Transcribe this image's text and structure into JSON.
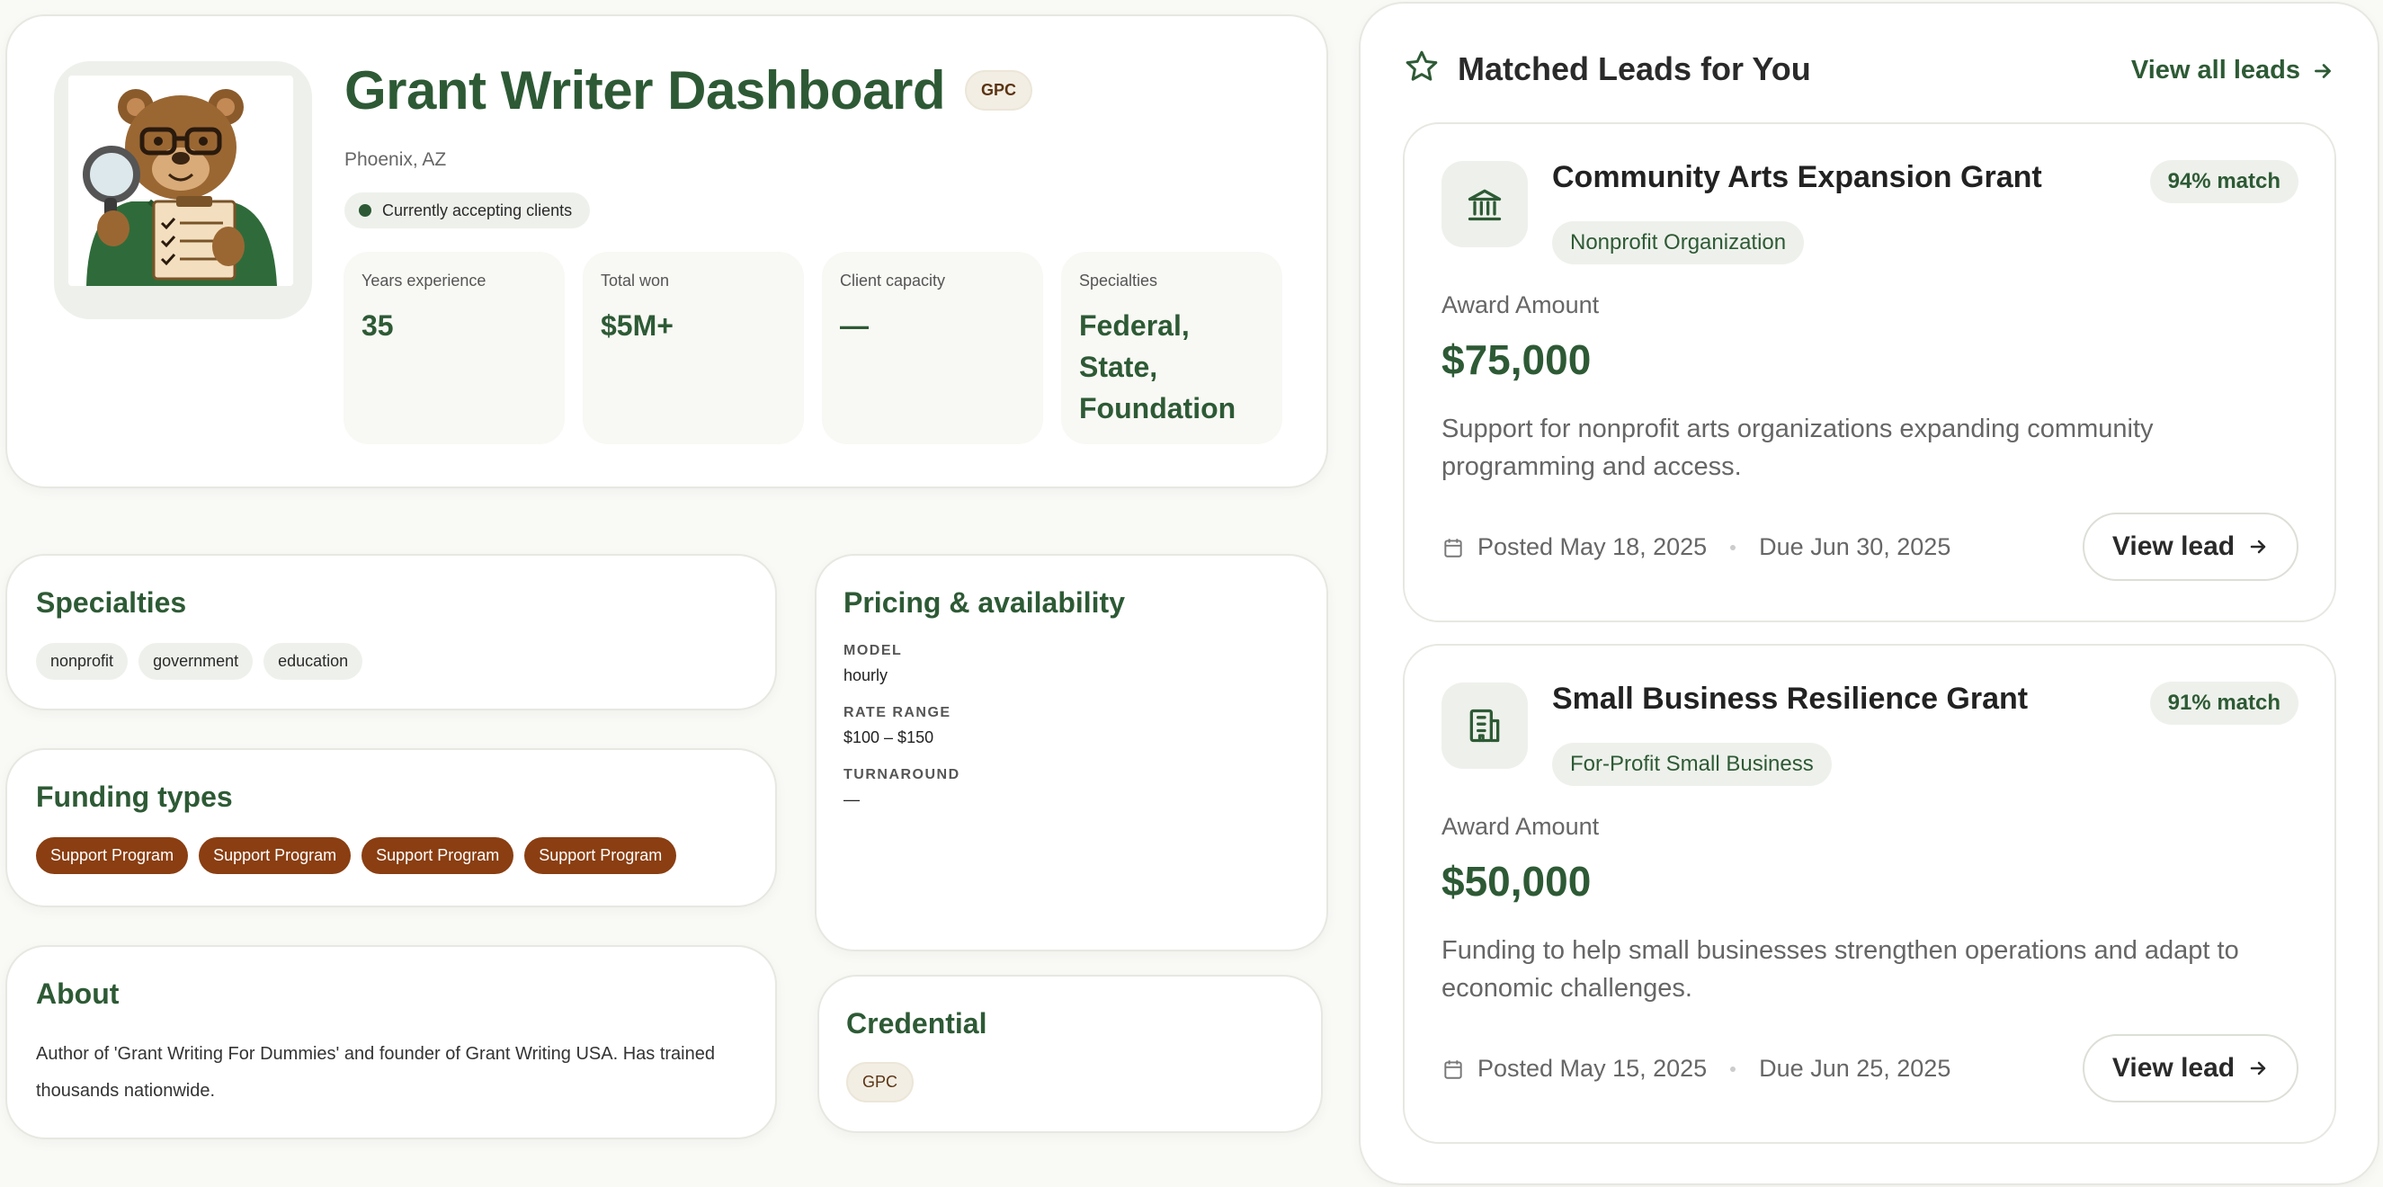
{
  "profile": {
    "title": "Grant Writer Dashboard",
    "credential_badge": "GPC",
    "location": "Phoenix, AZ",
    "status": "Currently accepting clients",
    "stats": [
      {
        "label": "Years experience",
        "value": "35"
      },
      {
        "label": "Total won",
        "value": "$5M+"
      },
      {
        "label": "Client capacity",
        "value": "—"
      },
      {
        "label": "Specialties",
        "value": "Federal, State, Foundation"
      }
    ]
  },
  "specialties": {
    "title": "Specialties",
    "tags": [
      "nonprofit",
      "government",
      "education"
    ]
  },
  "funding": {
    "title": "Funding types",
    "tags": [
      "Support Program",
      "Support Program",
      "Support Program",
      "Support Program"
    ]
  },
  "about": {
    "title": "About",
    "text": "Author of 'Grant Writing For Dummies' and founder of Grant Writing USA. Has trained thousands nationwide."
  },
  "pricing": {
    "title": "Pricing & availability",
    "model_label": "MODEL",
    "model_value": "hourly",
    "rate_label": "RATE RANGE",
    "rate_value": "$100 – $150",
    "turnaround_label": "TURNAROUND",
    "turnaround_value": "—"
  },
  "credential": {
    "title": "Credential",
    "value": "GPC"
  },
  "leads": {
    "title": "Matched Leads for You",
    "view_all": "View all leads",
    "items": [
      {
        "name": "Community Arts Expansion Grant",
        "category": "Nonprofit Organization",
        "match": "94% match",
        "award_label": "Award Amount",
        "award": "$75,000",
        "description": "Support for nonprofit arts organizations expanding community programming and access.",
        "posted": "Posted May 18, 2025",
        "due": "Due Jun 30, 2025",
        "button": "View lead",
        "icon": "landmark-icon"
      },
      {
        "name": "Small Business Resilience Grant",
        "category": "For-Profit Small Business",
        "match": "91% match",
        "award_label": "Award Amount",
        "award": "$50,000",
        "description": "Funding to help small businesses strengthen operations and adapt to economic challenges.",
        "posted": "Posted May 15, 2025",
        "due": "Due Jun 25, 2025",
        "button": "View lead",
        "icon": "building-icon"
      }
    ]
  },
  "colors": {
    "brand_green": "#2d5a35",
    "tag_brown": "#8a3e12",
    "soft_green": "#eef1eb"
  }
}
